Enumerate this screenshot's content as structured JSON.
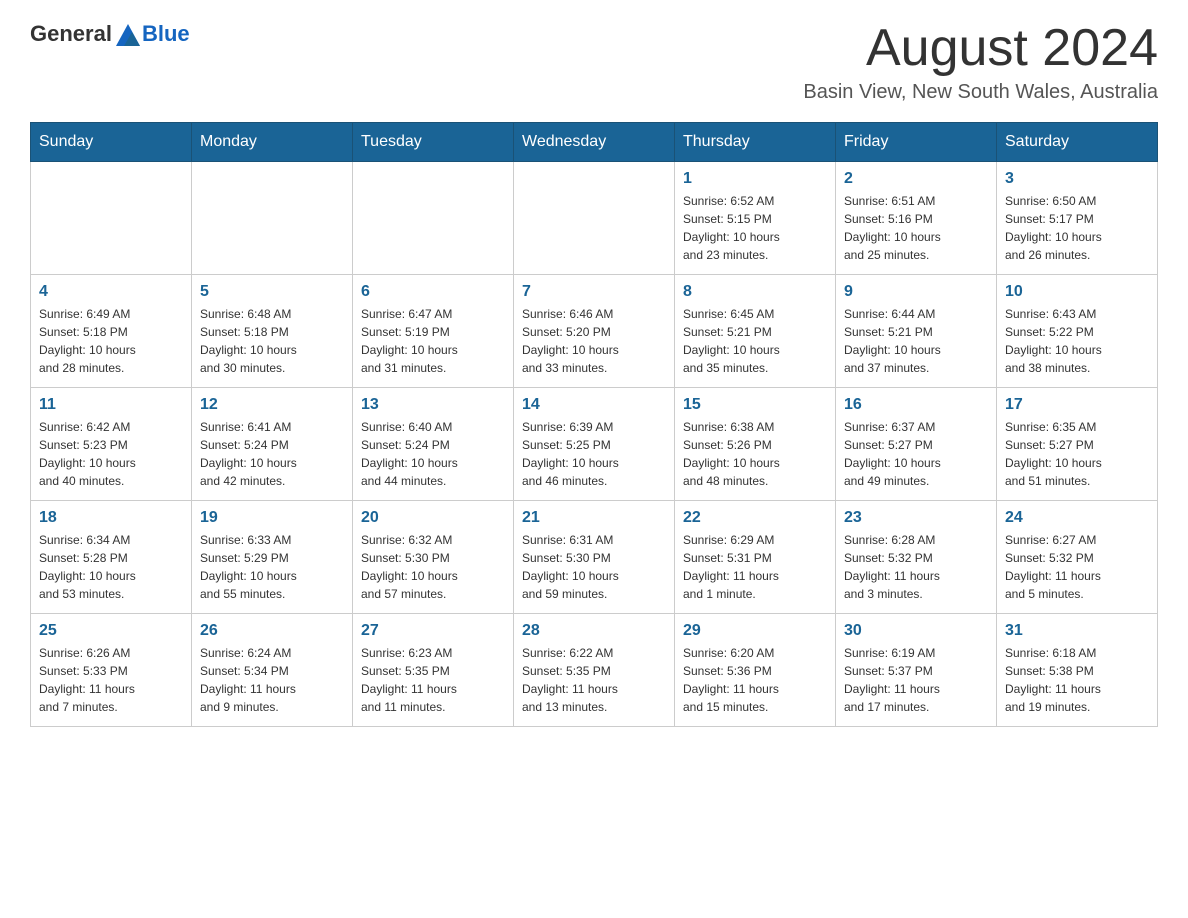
{
  "header": {
    "logo_general": "General",
    "logo_blue": "Blue",
    "month_title": "August 2024",
    "location": "Basin View, New South Wales, Australia"
  },
  "weekdays": [
    "Sunday",
    "Monday",
    "Tuesday",
    "Wednesday",
    "Thursday",
    "Friday",
    "Saturday"
  ],
  "weeks": [
    {
      "days": [
        {
          "num": "",
          "info": ""
        },
        {
          "num": "",
          "info": ""
        },
        {
          "num": "",
          "info": ""
        },
        {
          "num": "",
          "info": ""
        },
        {
          "num": "1",
          "info": "Sunrise: 6:52 AM\nSunset: 5:15 PM\nDaylight: 10 hours\nand 23 minutes."
        },
        {
          "num": "2",
          "info": "Sunrise: 6:51 AM\nSunset: 5:16 PM\nDaylight: 10 hours\nand 25 minutes."
        },
        {
          "num": "3",
          "info": "Sunrise: 6:50 AM\nSunset: 5:17 PM\nDaylight: 10 hours\nand 26 minutes."
        }
      ]
    },
    {
      "days": [
        {
          "num": "4",
          "info": "Sunrise: 6:49 AM\nSunset: 5:18 PM\nDaylight: 10 hours\nand 28 minutes."
        },
        {
          "num": "5",
          "info": "Sunrise: 6:48 AM\nSunset: 5:18 PM\nDaylight: 10 hours\nand 30 minutes."
        },
        {
          "num": "6",
          "info": "Sunrise: 6:47 AM\nSunset: 5:19 PM\nDaylight: 10 hours\nand 31 minutes."
        },
        {
          "num": "7",
          "info": "Sunrise: 6:46 AM\nSunset: 5:20 PM\nDaylight: 10 hours\nand 33 minutes."
        },
        {
          "num": "8",
          "info": "Sunrise: 6:45 AM\nSunset: 5:21 PM\nDaylight: 10 hours\nand 35 minutes."
        },
        {
          "num": "9",
          "info": "Sunrise: 6:44 AM\nSunset: 5:21 PM\nDaylight: 10 hours\nand 37 minutes."
        },
        {
          "num": "10",
          "info": "Sunrise: 6:43 AM\nSunset: 5:22 PM\nDaylight: 10 hours\nand 38 minutes."
        }
      ]
    },
    {
      "days": [
        {
          "num": "11",
          "info": "Sunrise: 6:42 AM\nSunset: 5:23 PM\nDaylight: 10 hours\nand 40 minutes."
        },
        {
          "num": "12",
          "info": "Sunrise: 6:41 AM\nSunset: 5:24 PM\nDaylight: 10 hours\nand 42 minutes."
        },
        {
          "num": "13",
          "info": "Sunrise: 6:40 AM\nSunset: 5:24 PM\nDaylight: 10 hours\nand 44 minutes."
        },
        {
          "num": "14",
          "info": "Sunrise: 6:39 AM\nSunset: 5:25 PM\nDaylight: 10 hours\nand 46 minutes."
        },
        {
          "num": "15",
          "info": "Sunrise: 6:38 AM\nSunset: 5:26 PM\nDaylight: 10 hours\nand 48 minutes."
        },
        {
          "num": "16",
          "info": "Sunrise: 6:37 AM\nSunset: 5:27 PM\nDaylight: 10 hours\nand 49 minutes."
        },
        {
          "num": "17",
          "info": "Sunrise: 6:35 AM\nSunset: 5:27 PM\nDaylight: 10 hours\nand 51 minutes."
        }
      ]
    },
    {
      "days": [
        {
          "num": "18",
          "info": "Sunrise: 6:34 AM\nSunset: 5:28 PM\nDaylight: 10 hours\nand 53 minutes."
        },
        {
          "num": "19",
          "info": "Sunrise: 6:33 AM\nSunset: 5:29 PM\nDaylight: 10 hours\nand 55 minutes."
        },
        {
          "num": "20",
          "info": "Sunrise: 6:32 AM\nSunset: 5:30 PM\nDaylight: 10 hours\nand 57 minutes."
        },
        {
          "num": "21",
          "info": "Sunrise: 6:31 AM\nSunset: 5:30 PM\nDaylight: 10 hours\nand 59 minutes."
        },
        {
          "num": "22",
          "info": "Sunrise: 6:29 AM\nSunset: 5:31 PM\nDaylight: 11 hours\nand 1 minute."
        },
        {
          "num": "23",
          "info": "Sunrise: 6:28 AM\nSunset: 5:32 PM\nDaylight: 11 hours\nand 3 minutes."
        },
        {
          "num": "24",
          "info": "Sunrise: 6:27 AM\nSunset: 5:32 PM\nDaylight: 11 hours\nand 5 minutes."
        }
      ]
    },
    {
      "days": [
        {
          "num": "25",
          "info": "Sunrise: 6:26 AM\nSunset: 5:33 PM\nDaylight: 11 hours\nand 7 minutes."
        },
        {
          "num": "26",
          "info": "Sunrise: 6:24 AM\nSunset: 5:34 PM\nDaylight: 11 hours\nand 9 minutes."
        },
        {
          "num": "27",
          "info": "Sunrise: 6:23 AM\nSunset: 5:35 PM\nDaylight: 11 hours\nand 11 minutes."
        },
        {
          "num": "28",
          "info": "Sunrise: 6:22 AM\nSunset: 5:35 PM\nDaylight: 11 hours\nand 13 minutes."
        },
        {
          "num": "29",
          "info": "Sunrise: 6:20 AM\nSunset: 5:36 PM\nDaylight: 11 hours\nand 15 minutes."
        },
        {
          "num": "30",
          "info": "Sunrise: 6:19 AM\nSunset: 5:37 PM\nDaylight: 11 hours\nand 17 minutes."
        },
        {
          "num": "31",
          "info": "Sunrise: 6:18 AM\nSunset: 5:38 PM\nDaylight: 11 hours\nand 19 minutes."
        }
      ]
    }
  ]
}
